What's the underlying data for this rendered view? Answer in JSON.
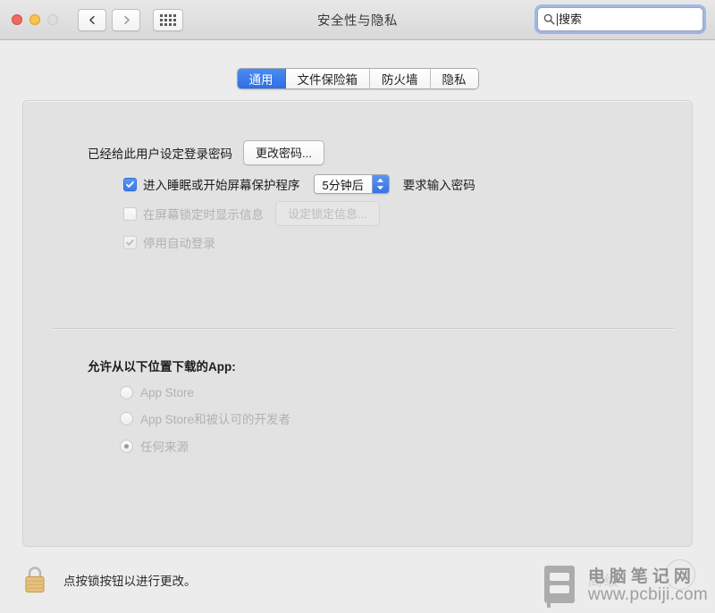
{
  "window": {
    "title": "安全性与隐私",
    "traffic_lights": [
      "close-button",
      "minimize-button",
      "zoom-button-disabled"
    ],
    "nav": {
      "back": "back-icon",
      "forward": "forward-icon",
      "grid": "show-all-icon"
    }
  },
  "search": {
    "placeholder": "搜索",
    "value": "",
    "icon": "search-icon",
    "focused": true
  },
  "tabs": [
    {
      "label": "通用",
      "active": true
    },
    {
      "label": "文件保险箱",
      "active": false
    },
    {
      "label": "防火墙",
      "active": false
    },
    {
      "label": "隐私",
      "active": false
    }
  ],
  "general": {
    "password_status": "已经给此用户设定登录密码",
    "change_password_button": "更改密码...",
    "require_password": {
      "prefix": "进入睡眠或开始屏幕保护程序",
      "delay_value": "5分钟后",
      "suffix": "要求输入密码",
      "checked": true,
      "enabled": true
    },
    "show_message": {
      "label": "在屏幕锁定时显示信息",
      "button": "设定锁定信息...",
      "checked": false,
      "enabled": false
    },
    "disable_auto_login": {
      "label": "停用自动登录",
      "checked": true,
      "enabled": false
    }
  },
  "download_sources": {
    "title": "允许从以下位置下载的App:",
    "enabled": false,
    "options": [
      {
        "label": "App Store",
        "selected": false
      },
      {
        "label": "App Store和被认可的开发者",
        "selected": false
      },
      {
        "label": "任何来源",
        "selected": true
      }
    ]
  },
  "footer": {
    "lock_icon": "lock-closed-icon",
    "message": "点按锁按钮以进行更改。"
  },
  "watermark": {
    "logo": "notebook-icon",
    "site_name": "电脑笔记网",
    "url": "www.pcbiji.com",
    "ghost_text": "高级"
  },
  "colors": {
    "accent": "#3c7bea",
    "window_bg": "#ececec",
    "panel_bg": "#e2e2e2",
    "text": "#1c1c1c",
    "disabled_text": "#b2b2b2",
    "lock_gold": "#e8c27c"
  }
}
